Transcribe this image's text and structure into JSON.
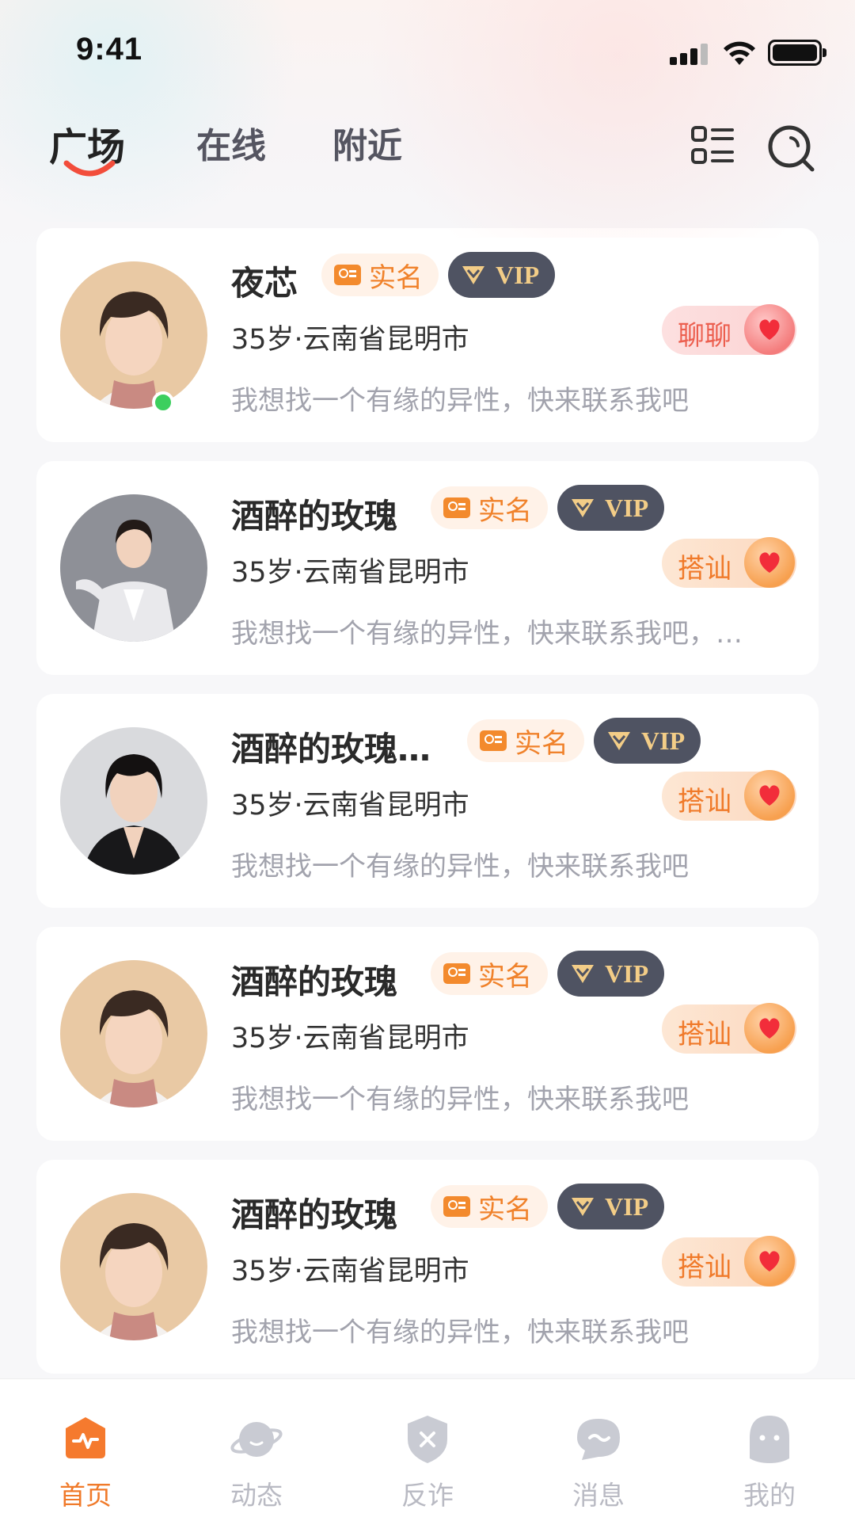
{
  "status_bar": {
    "time": "9:41"
  },
  "top_nav": {
    "tabs": [
      {
        "label": "广场",
        "active": true
      },
      {
        "label": "在线",
        "active": false
      },
      {
        "label": "附近",
        "active": false
      }
    ],
    "icons": [
      "list-view-icon",
      "search-icon"
    ]
  },
  "cards": [
    {
      "name": "夜芯",
      "verified": "实名",
      "vip": "VIP",
      "meta": "35岁·云南省昆明市",
      "bio": "我想找一个有缘的异性，快来联系我吧",
      "action": "聊聊",
      "online": true
    },
    {
      "name": "酒醉的玫瑰",
      "verified": "实名",
      "vip": "VIP",
      "meta": "35岁·云南省昆明市",
      "bio": "我想找一个有缘的异性，快来联系我吧，…",
      "action": "搭讪",
      "online": false
    },
    {
      "name": "酒醉的玫瑰…",
      "verified": "实名",
      "vip": "VIP",
      "meta": "35岁·云南省昆明市",
      "bio": "我想找一个有缘的异性，快来联系我吧",
      "action": "搭讪",
      "online": false
    },
    {
      "name": "酒醉的玫瑰",
      "verified": "实名",
      "vip": "VIP",
      "meta": "35岁·云南省昆明市",
      "bio": "我想找一个有缘的异性，快来联系我吧",
      "action": "搭讪",
      "online": false
    },
    {
      "name": "酒醉的玫瑰",
      "verified": "实名",
      "vip": "VIP",
      "meta": "35岁·云南省昆明市",
      "bio": "我想找一个有缘的异性，快来联系我吧",
      "action": "搭讪",
      "online": false
    }
  ],
  "tabbar": [
    {
      "label": "首页",
      "active": true,
      "icon": "home-icon"
    },
    {
      "label": "动态",
      "active": false,
      "icon": "planet-icon"
    },
    {
      "label": "反诈",
      "active": false,
      "icon": "shield-icon"
    },
    {
      "label": "消息",
      "active": false,
      "icon": "message-icon"
    },
    {
      "label": "我的",
      "active": false,
      "icon": "profile-icon"
    }
  ],
  "colors": {
    "accent": "#f07a2a",
    "vip_bg": "#4f5362",
    "vip_text": "#f3cd87",
    "online": "#3ccf5e"
  }
}
